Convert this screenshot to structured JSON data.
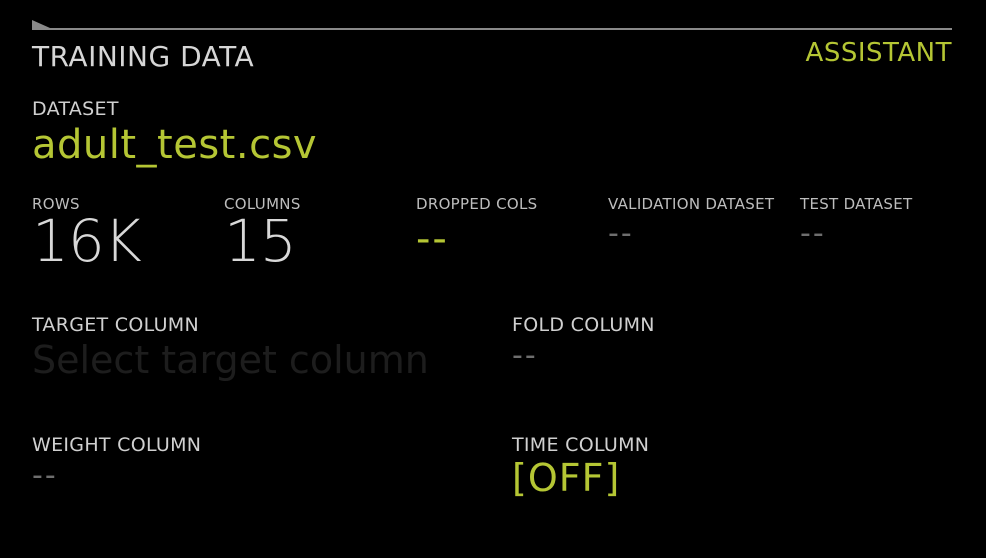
{
  "header": {
    "title": "TRAINING DATA",
    "assistant_label": "ASSISTANT"
  },
  "dataset": {
    "label": "DATASET",
    "value": "adult_test.csv"
  },
  "stats": {
    "rows_label": "ROWS",
    "rows_value": "16K",
    "columns_label": "COLUMNS",
    "columns_value": "15",
    "dropped_label": "DROPPED COLS",
    "dropped_value": "--",
    "validation_label": "VALIDATION DATASET",
    "validation_value": "--",
    "test_label": "TEST DATASET",
    "test_value": "--"
  },
  "columns": {
    "target_label": "TARGET COLUMN",
    "target_placeholder": "Select target column",
    "fold_label": "FOLD COLUMN",
    "fold_value": "--",
    "weight_label": "WEIGHT COLUMN",
    "weight_value": "--",
    "time_label": "TIME COLUMN",
    "time_value": "[OFF]"
  },
  "colors": {
    "background": "#000000",
    "accent": "#b5c634",
    "text": "#d0d0d0",
    "muted": "#6e6e6e"
  }
}
